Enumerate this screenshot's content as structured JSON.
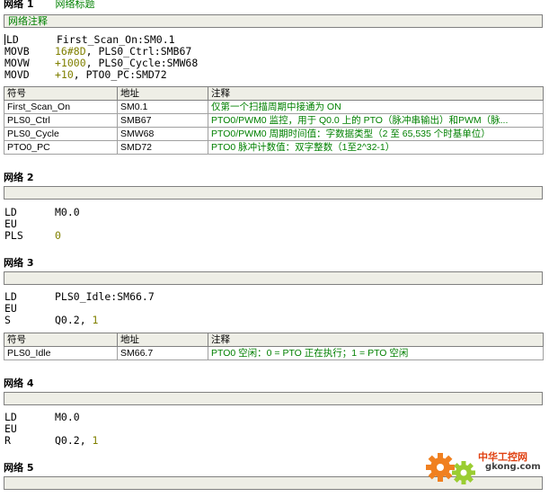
{
  "networks": [
    {
      "title": "网络 1",
      "subtitle": "网络标题",
      "comment": "网络注释",
      "code": [
        {
          "op": "LD",
          "args": [
            {
              "t": "First_Scan_On:SM0.1",
              "num": false
            }
          ]
        },
        {
          "op": "MOVB",
          "args": [
            {
              "t": "16#8D",
              "num": true
            },
            {
              "t": ", PLS0_Ctrl:SMB67",
              "num": false
            }
          ]
        },
        {
          "op": "MOVW",
          "args": [
            {
              "t": "+1000",
              "num": true
            },
            {
              "t": ", PLS0_Cycle:SMW68",
              "num": false
            }
          ]
        },
        {
          "op": "MOVD",
          "args": [
            {
              "t": "+10",
              "num": true
            },
            {
              "t": ", PTO0_PC:SMD72",
              "num": false
            }
          ]
        }
      ],
      "symbol_table": {
        "headers": [
          "符号",
          "地址",
          "注释"
        ],
        "rows": [
          [
            "First_Scan_On",
            "SM0.1",
            "仅第一个扫描周期中接通为 ON"
          ],
          [
            "PLS0_Ctrl",
            "SMB67",
            "PTO0/PWM0 监控，用于 Q0.0 上的 PTO（脉冲串输出）和PWM（脉..."
          ],
          [
            "PLS0_Cycle",
            "SMW68",
            "PTO0/PWM0 周期时间值：字数据类型（2 至 65,535 个时基单位）"
          ],
          [
            "PTO0_PC",
            "SMD72",
            "PTO0 脉冲计数值：双字整数（1至2^32-1）"
          ]
        ]
      }
    },
    {
      "title": "网络 2",
      "comment": "",
      "code": [
        {
          "op": "LD",
          "args": [
            {
              "t": "M0.0",
              "num": false
            }
          ]
        },
        {
          "op": "EU",
          "args": []
        },
        {
          "op": "PLS",
          "args": [
            {
              "t": "0",
              "num": true
            }
          ]
        }
      ]
    },
    {
      "title": "网络 3",
      "comment": "",
      "code": [
        {
          "op": "LD",
          "args": [
            {
              "t": "PLS0_Idle:SM66.7",
              "num": false
            }
          ]
        },
        {
          "op": "EU",
          "args": []
        },
        {
          "op": "S",
          "args": [
            {
              "t": "Q0.2, ",
              "num": false
            },
            {
              "t": "1",
              "num": true
            }
          ]
        }
      ],
      "symbol_table": {
        "headers": [
          "符号",
          "地址",
          "注释"
        ],
        "rows": [
          [
            "PLS0_Idle",
            "SM66.7",
            "PTO0 空闲：0 = PTO 正在执行；1 = PTO 空闲"
          ]
        ]
      }
    },
    {
      "title": "网络 4",
      "comment": "",
      "code": [
        {
          "op": "LD",
          "args": [
            {
              "t": "M0.0",
              "num": false
            }
          ]
        },
        {
          "op": "EU",
          "args": []
        },
        {
          "op": "R",
          "args": [
            {
              "t": "Q0.2, ",
              "num": false
            },
            {
              "t": "1",
              "num": true
            }
          ]
        }
      ]
    },
    {
      "title": "网络 5",
      "comment": ""
    }
  ],
  "watermark": {
    "name": "中华工控网",
    "url": "gkong.com",
    "colors": {
      "gear_orange": "#f08020",
      "gear_green": "#9acd32",
      "text_red": "#e04010"
    }
  },
  "colors": {
    "comment_green": "#008000",
    "number_olive": "#808000",
    "bar_fill": "#eeeee6"
  }
}
